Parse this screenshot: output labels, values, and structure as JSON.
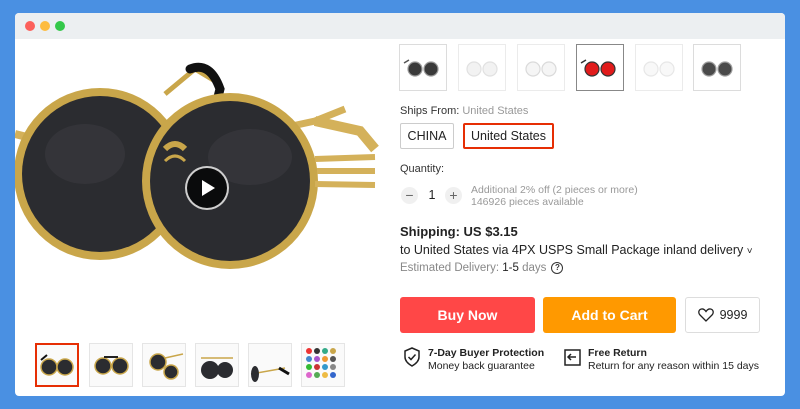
{
  "window": {
    "controls": [
      "close",
      "minimize",
      "zoom"
    ]
  },
  "product": {
    "main_image_icon": "round-sunglasses-gold-frame-black-lens",
    "play_icon": "play-icon",
    "thumbnails": [
      {
        "icon": "sunglasses-front",
        "selected": true
      },
      {
        "icon": "sunglasses-angle",
        "selected": false
      },
      {
        "icon": "sunglasses-side",
        "selected": false
      },
      {
        "icon": "sunglasses-folded",
        "selected": false
      },
      {
        "icon": "sunglasses-profile",
        "selected": false
      },
      {
        "icon": "color-swatch-grid",
        "selected": false
      }
    ],
    "variants": [
      {
        "lens": "#3a3a3a",
        "frame": "#9a9a9a"
      },
      {
        "lens": "#e8e8e8",
        "frame": "#c9c9c9"
      },
      {
        "lens": "#eeeeee",
        "frame": "#bdbdbd"
      },
      {
        "lens": "#e11b1b",
        "frame": "#333333",
        "selected": true
      },
      {
        "lens": "#f3f3f3",
        "frame": "#d5d5d5"
      },
      {
        "lens": "#4a4a4a",
        "frame": "#9e9e9e"
      }
    ]
  },
  "ships_from": {
    "label": "Ships From:",
    "value": "United States",
    "options": [
      "CHINA",
      "United States"
    ],
    "selected": "United States"
  },
  "quantity": {
    "label": "Quantity:",
    "minus": "−",
    "plus": "+",
    "value": "1",
    "note_line1": "Additional 2% off (2 pieces or more)",
    "note_line2": "146926 pieces available"
  },
  "shipping": {
    "title": "Shipping: US $3.15",
    "method": "to United States via 4PX USPS Small Package inland delivery",
    "chevron": "˅",
    "delivery_label": "Estimated Delivery:",
    "delivery_days": "1-5",
    "delivery_unit": "days",
    "help": "?"
  },
  "actions": {
    "buy_now": "Buy Now",
    "add_to_cart": "Add to Cart",
    "wishlist_count": "9999"
  },
  "colors": {
    "buy": "#ff4747",
    "cart": "#ff9900",
    "selected_border": "#e62e04",
    "background": "#4a90e2"
  },
  "guarantees": [
    {
      "icon": "shield-check-icon",
      "title": "7-Day Buyer Protection",
      "subtitle": "Money back guarantee"
    },
    {
      "icon": "return-arrow-icon",
      "title": "Free Return",
      "subtitle": "Return for any reason within 15 days"
    }
  ]
}
